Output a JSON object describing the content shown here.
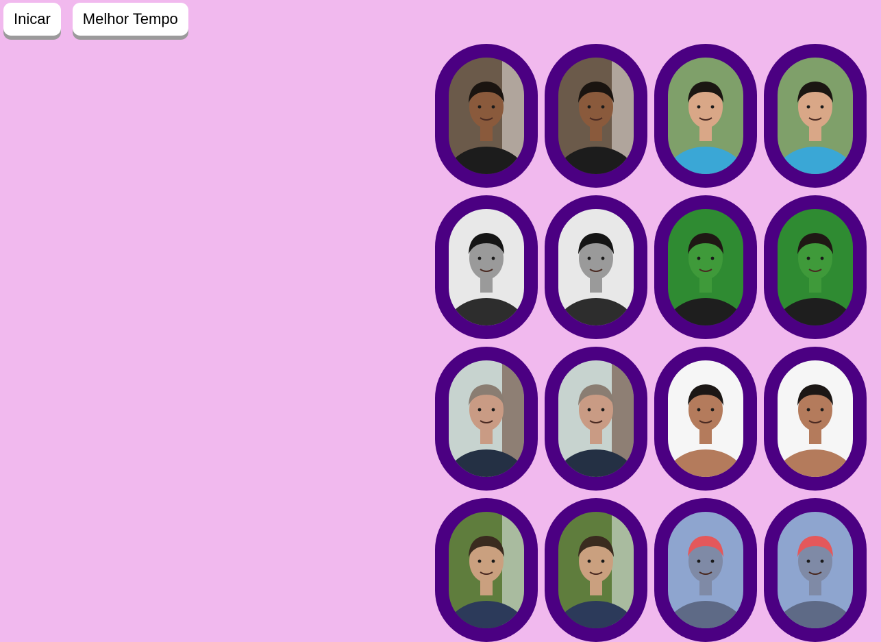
{
  "toolbar": {
    "start_label": "Inicar",
    "best_time_label": "Melhor Tempo"
  },
  "colors": {
    "background": "#f1b9ee",
    "card_frame": "#4b0082",
    "button_bg": "#ffffff",
    "button_shadow": "#9b9a9b"
  },
  "board": {
    "columns": 4,
    "rows": 4,
    "cards": [
      {
        "photo": "young man with white dog, dark shirt",
        "skin": "#8a5a3c",
        "hair": "#1a1410",
        "shirt": "#1c1c1c",
        "bg": "#6b5a4a",
        "extra": "#e9e4e0"
      },
      {
        "photo": "young man with white dog, dark shirt",
        "skin": "#8a5a3c",
        "hair": "#1a1410",
        "shirt": "#1c1c1c",
        "bg": "#6b5a4a",
        "extra": "#e9e4e0"
      },
      {
        "photo": "smiling curly-haired teen outdoors",
        "skin": "#d9a787",
        "hair": "#1b1612",
        "shirt": "#3aa7d6",
        "bg": "#7fa06a",
        "extra": ""
      },
      {
        "photo": "smiling curly-haired teen outdoors",
        "skin": "#d9a787",
        "hair": "#1b1612",
        "shirt": "#3aa7d6",
        "bg": "#7fa06a",
        "extra": ""
      },
      {
        "photo": "black and white portrait of young man",
        "skin": "#9a9a9a",
        "hair": "#151515",
        "shirt": "#2d2d2d",
        "bg": "#e8e8e8",
        "extra": ""
      },
      {
        "photo": "black and white portrait of young man",
        "skin": "#9a9a9a",
        "hair": "#151515",
        "shirt": "#2d2d2d",
        "bg": "#e8e8e8",
        "extra": ""
      },
      {
        "photo": "long-haired person with green hulk face paint",
        "skin": "#3f9a3a",
        "hair": "#1f1814",
        "shirt": "#1e1e1e",
        "bg": "#2f8b32",
        "extra": ""
      },
      {
        "photo": "long-haired person with green hulk face paint",
        "skin": "#3f9a3a",
        "hair": "#1f1814",
        "shirt": "#1e1e1e",
        "bg": "#2f8b32",
        "extra": ""
      },
      {
        "photo": "bearded man with beanie, glasses and headphones",
        "skin": "#c99b84",
        "hair": "#8a7d72",
        "shirt": "#243044",
        "bg": "#c7d3cf",
        "extra": "#5e3b2a"
      },
      {
        "photo": "bearded man with beanie, glasses and headphones",
        "skin": "#c99b84",
        "hair": "#8a7d72",
        "shirt": "#243044",
        "bg": "#c7d3cf",
        "extra": "#5e3b2a"
      },
      {
        "photo": "shirtless young man with glasses, white background",
        "skin": "#b47b5c",
        "hair": "#1c1715",
        "shirt": "#b47b5c",
        "bg": "#f6f6f6",
        "extra": ""
      },
      {
        "photo": "shirtless young man with glasses, white background",
        "skin": "#b47b5c",
        "hair": "#1c1715",
        "shirt": "#b47b5c",
        "bg": "#f6f6f6",
        "extra": ""
      },
      {
        "photo": "young man with glasses near waterfall",
        "skin": "#caa07f",
        "hair": "#3a2b1f",
        "shirt": "#2c3a5a",
        "bg": "#5f7d3d",
        "extra": "#e6eef0"
      },
      {
        "photo": "young man with glasses near waterfall",
        "skin": "#caa07f",
        "hair": "#3a2b1f",
        "shirt": "#2c3a5a",
        "bg": "#5f7d3d",
        "extra": "#e6eef0"
      },
      {
        "photo": "blurry young man with red cap, blue tint",
        "skin": "#7f8aa6",
        "hair": "#e4585b",
        "shirt": "#5e6a86",
        "bg": "#8ea5cf",
        "extra": ""
      },
      {
        "photo": "blurry young man with red cap, blue tint",
        "skin": "#7f8aa6",
        "hair": "#e4585b",
        "shirt": "#5e6a86",
        "bg": "#8ea5cf",
        "extra": ""
      }
    ]
  }
}
